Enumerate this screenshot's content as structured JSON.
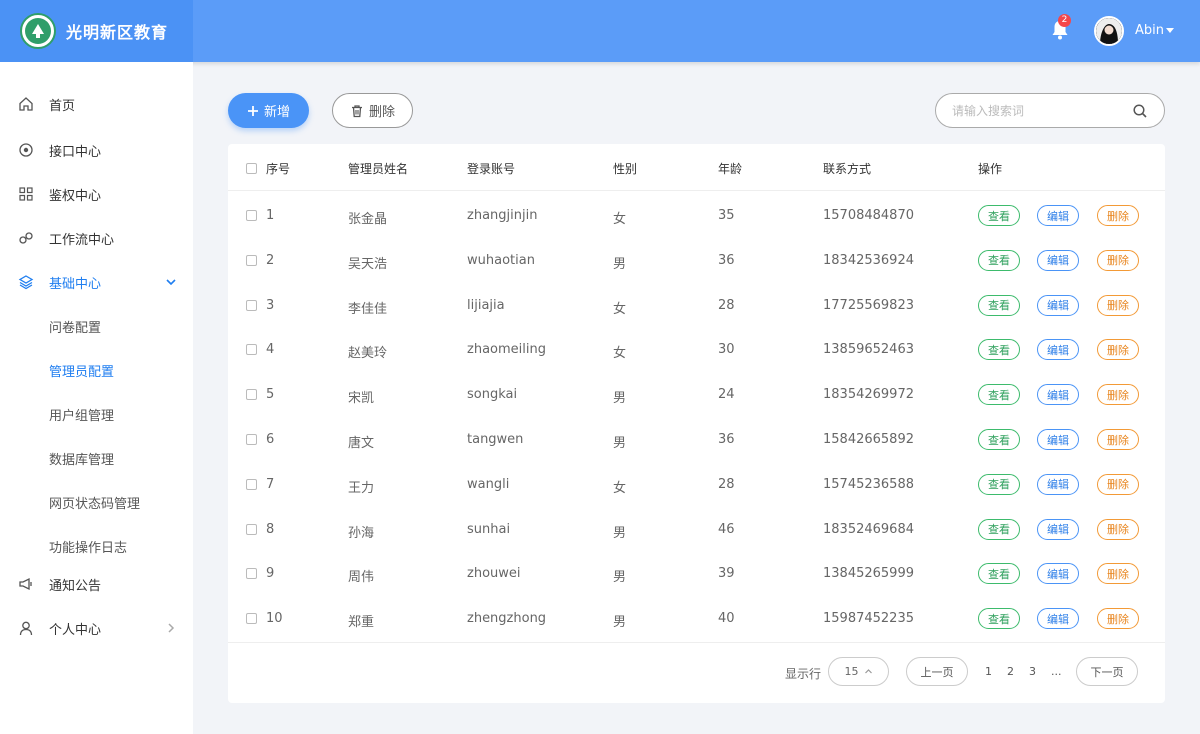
{
  "app": {
    "title": "光明新区教育"
  },
  "header": {
    "notification_count": "2",
    "username": "Abin"
  },
  "sidebar": {
    "items": [
      {
        "label": "首页",
        "icon": "home-icon"
      },
      {
        "label": "接口中心",
        "icon": "target-icon"
      },
      {
        "label": "鉴权中心",
        "icon": "grid-icon"
      },
      {
        "label": "工作流中心",
        "icon": "link-icon"
      },
      {
        "label": "基础中心",
        "icon": "layers-icon",
        "expanded": true
      },
      {
        "label": "通知公告",
        "icon": "megaphone-icon"
      },
      {
        "label": "个人中心",
        "icon": "user-icon"
      }
    ],
    "subitems": [
      {
        "label": "问卷配置"
      },
      {
        "label": "管理员配置",
        "active": true
      },
      {
        "label": "用户组管理"
      },
      {
        "label": "数据库管理"
      },
      {
        "label": "网页状态码管理"
      },
      {
        "label": "功能操作日志"
      }
    ]
  },
  "toolbar": {
    "add_label": "新增",
    "delete_label": "删除",
    "search_placeholder": "请输入搜索词"
  },
  "table": {
    "columns": [
      "序号",
      "管理员姓名",
      "登录账号",
      "性别",
      "年龄",
      "联系方式",
      "操作"
    ],
    "actions": {
      "view": "查看",
      "edit": "编辑",
      "delete": "删除"
    },
    "rows": [
      {
        "no": "1",
        "name": "张金晶",
        "account": "zhangjinjin",
        "gender": "女",
        "age": "35",
        "phone": "15708484870"
      },
      {
        "no": "2",
        "name": "吴天浩",
        "account": "wuhaotian",
        "gender": "男",
        "age": "36",
        "phone": "18342536924"
      },
      {
        "no": "3",
        "name": "李佳佳",
        "account": "lijiajia",
        "gender": "女",
        "age": "28",
        "phone": "17725569823"
      },
      {
        "no": "4",
        "name": "赵美玲",
        "account": "zhaomeiling",
        "gender": "女",
        "age": "30",
        "phone": "13859652463"
      },
      {
        "no": "5",
        "name": "宋凯",
        "account": "songkai",
        "gender": "男",
        "age": "24",
        "phone": "18354269972"
      },
      {
        "no": "6",
        "name": "唐文",
        "account": "tangwen",
        "gender": "男",
        "age": "36",
        "phone": "15842665892"
      },
      {
        "no": "7",
        "name": "王力",
        "account": "wangli",
        "gender": "女",
        "age": "28",
        "phone": "15745236588"
      },
      {
        "no": "8",
        "name": "孙海",
        "account": "sunhai",
        "gender": "男",
        "age": "46",
        "phone": "18352469684"
      },
      {
        "no": "9",
        "name": "周伟",
        "account": "zhouwei",
        "gender": "男",
        "age": "39",
        "phone": "13845265999"
      },
      {
        "no": "10",
        "name": "郑重",
        "account": "zhengzhong",
        "gender": "男",
        "age": "40",
        "phone": "15987452235"
      }
    ]
  },
  "pagination": {
    "rows_label": "显示行",
    "page_size": "15",
    "prev": "上一页",
    "next": "下一页",
    "pages": [
      "1",
      "2",
      "3",
      "..."
    ]
  },
  "colors": {
    "primary": "#4a94f7",
    "view": "#3dbb6c",
    "edit": "#4a94f7",
    "delete": "#f39a36",
    "badge": "#f4474b"
  }
}
